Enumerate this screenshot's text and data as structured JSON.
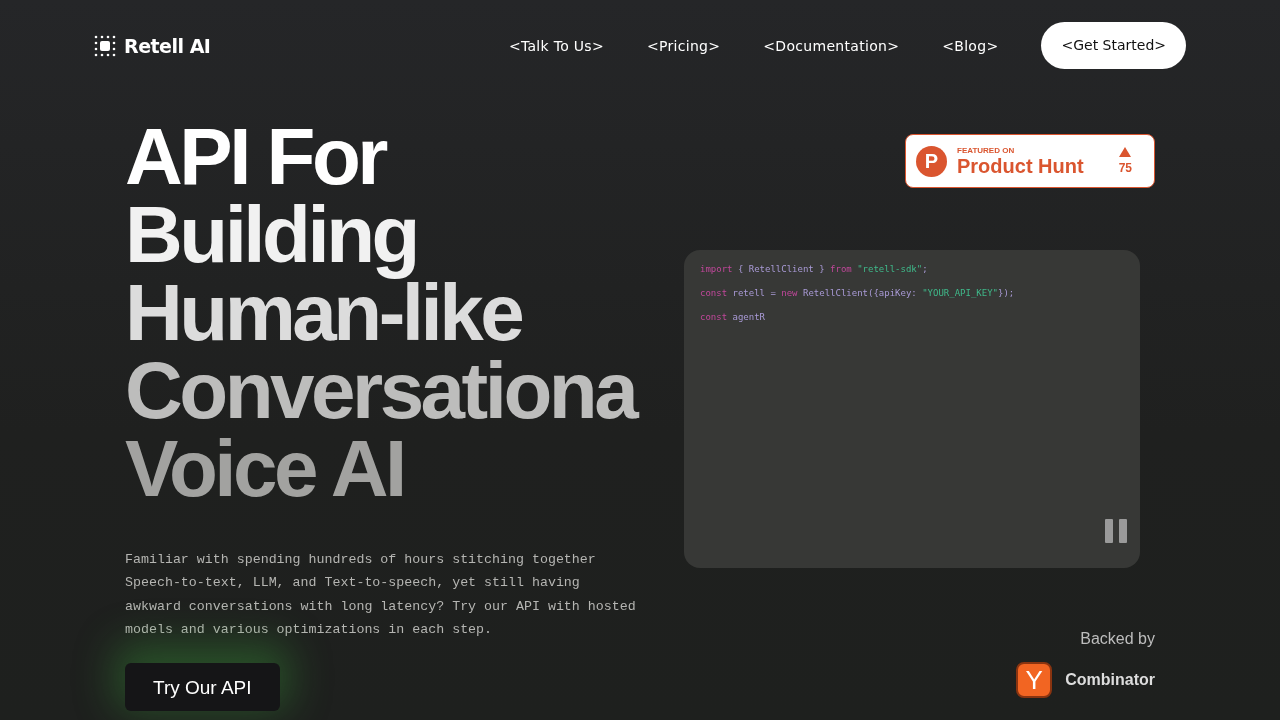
{
  "brand": {
    "name": "Retell AI"
  },
  "nav": [
    {
      "label": "<Talk To Us>"
    },
    {
      "label": "<Pricing>"
    },
    {
      "label": "<Documentation>"
    },
    {
      "label": "<Blog>"
    }
  ],
  "cta": {
    "label": "<Get Started>"
  },
  "headline": [
    "API For",
    "Building",
    "Human-like",
    "Conversationa",
    "Voice AI"
  ],
  "description": "Familiar with spending hundreds of hours stitching together Speech-to-text, LLM, and Text-to-speech, yet still having awkward conversations with long latency? Try our API with hosted models and various optimizations in each step.",
  "try_button": {
    "label": "Try Our API"
  },
  "badge": {
    "logo": "P",
    "eyebrow": "FEATURED ON",
    "title": "Product Hunt",
    "votes": "75"
  },
  "code": {
    "lines": [
      [
        {
          "text": "import",
          "kind": "keyword"
        },
        {
          "text": " { RetellClient } ",
          "kind": "plain"
        },
        {
          "text": "from ",
          "kind": "keyword"
        },
        {
          "text": "\"retell-sdk\"",
          "kind": "string"
        },
        {
          "text": ";",
          "kind": "plain"
        }
      ],
      [
        {
          "text": "const",
          "kind": "keyword"
        },
        {
          "text": " retell = ",
          "kind": "plain"
        },
        {
          "text": "new",
          "kind": "keyword"
        },
        {
          "text": " RetellClient({apiKey: ",
          "kind": "plain"
        },
        {
          "text": "\"YOUR_API_KEY\"",
          "kind": "string"
        },
        {
          "text": "});",
          "kind": "plain"
        }
      ],
      [
        {
          "text": "const",
          "kind": "keyword"
        },
        {
          "text": " agentR",
          "kind": "plain"
        }
      ]
    ]
  },
  "backed": {
    "label": "Backed by",
    "logo": "Y",
    "name": "Combinator"
  }
}
